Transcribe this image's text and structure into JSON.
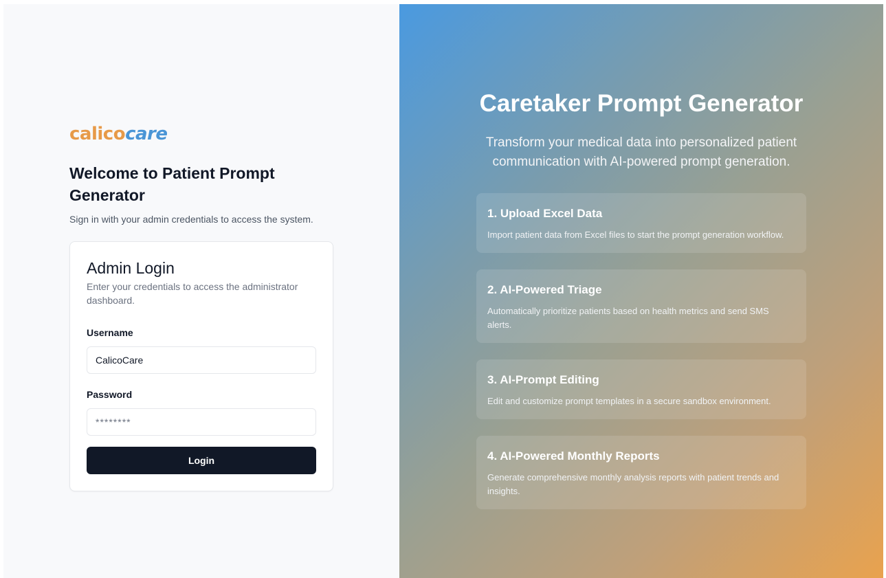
{
  "brand": {
    "part1": "calico",
    "part2": "care"
  },
  "welcome": {
    "heading": "Welcome to Patient Prompt Generator",
    "subtitle": "Sign in with your admin credentials to access the system."
  },
  "login_card": {
    "title": "Admin Login",
    "description": "Enter your credentials to access the administrator dashboard.",
    "username_label": "Username",
    "username_value": "CalicoCare",
    "password_label": "Password",
    "password_placeholder": "********",
    "login_button": "Login"
  },
  "hero": {
    "title": "Caretaker Prompt Generator",
    "subtitle": "Transform your medical data into personalized patient communication with AI-powered prompt generation."
  },
  "features": [
    {
      "title": "1. Upload Excel Data",
      "description": "Import patient data from Excel files to start the prompt generation workflow."
    },
    {
      "title": "2. AI-Powered Triage",
      "description": "Automatically prioritize patients based on health metrics and send SMS alerts."
    },
    {
      "title": "3. AI-Prompt Editing",
      "description": "Edit and customize prompt templates in a secure sandbox environment."
    },
    {
      "title": "4. AI-Powered Monthly Reports",
      "description": "Generate comprehensive monthly analysis reports with patient trends and insights."
    }
  ],
  "colors": {
    "brand_orange": "#e79a48",
    "brand_blue": "#4a95d6",
    "button_dark": "#111827",
    "gradient_start": "#4a9ae0",
    "gradient_end": "#e9a24e"
  }
}
